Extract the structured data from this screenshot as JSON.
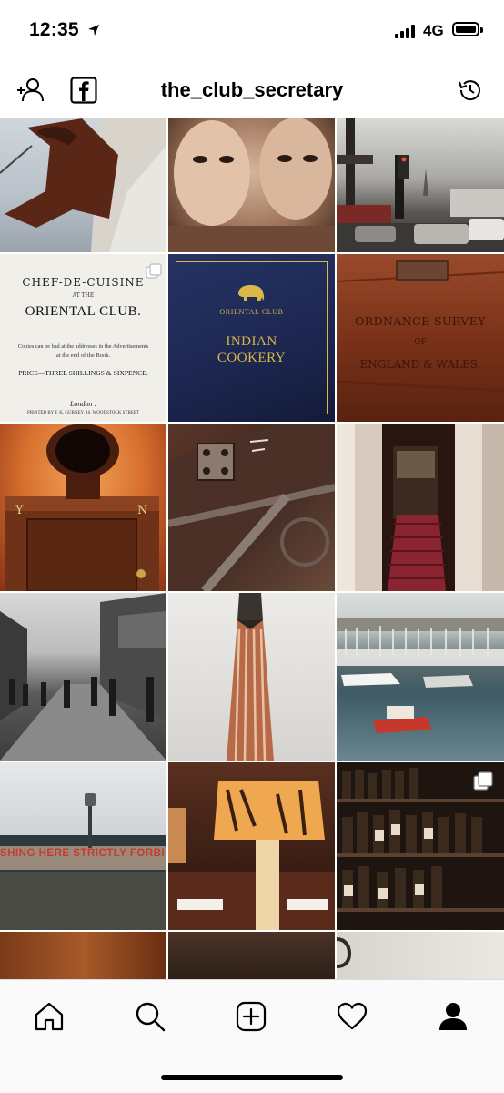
{
  "status": {
    "time": "12:35",
    "network": "4G"
  },
  "header": {
    "username": "the_club_secretary"
  },
  "posts": [
    {
      "alt": "silhouette-sign"
    },
    {
      "alt": "masks"
    },
    {
      "alt": "paris-street"
    },
    {
      "alt": "book-title-page",
      "lines": [
        "CHEF-DE-CUISINE",
        "AT THE",
        "ORIENTAL CLUB.",
        "Copies can be had at the addresses in the Advertisements",
        "at the end of the Book.",
        "PRICE—THREE SHILLINGS & SIXPENCE.",
        "London :",
        "PRINTED BY F. K. GURNEY, 16, WOODSTOCK STREET"
      ]
    },
    {
      "alt": "indian-cookery-book",
      "lines": [
        "ORIENTAL CLUB",
        "INDIAN",
        "COOKERY"
      ]
    },
    {
      "alt": "ordnance-survey-box",
      "lines": [
        "ORDNANCE SURVEY",
        "OF",
        "ENGLAND & WALES."
      ]
    },
    {
      "alt": "ballot-box",
      "lines": [
        "Y",
        "N"
      ]
    },
    {
      "alt": "industrial-detail"
    },
    {
      "alt": "staircase"
    },
    {
      "alt": "old-street"
    },
    {
      "alt": "chimney-tower"
    },
    {
      "alt": "marina"
    },
    {
      "alt": "seafront-sign",
      "lines": [
        "SHING HERE STRICTLY FORBIDD"
      ]
    },
    {
      "alt": "restaurant-lamp"
    },
    {
      "alt": "wine-cellar"
    },
    {
      "alt": "partial-1"
    },
    {
      "alt": "partial-2"
    },
    {
      "alt": "partial-3"
    }
  ],
  "tabs": [
    "home",
    "search",
    "new-post",
    "activity",
    "profile"
  ],
  "colors": {
    "accent_gold": "#d9b84a",
    "book_blue": "#1f2a52",
    "wood": "#8a3b1f"
  }
}
